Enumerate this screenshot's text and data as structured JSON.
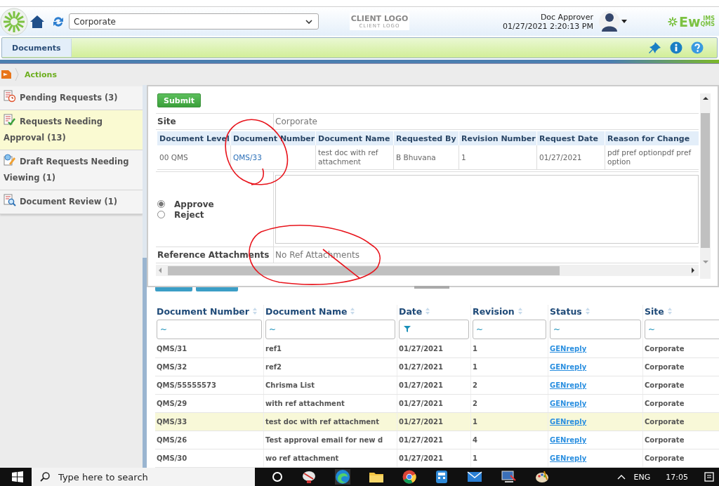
{
  "header": {
    "site_select": "Corporate",
    "client_logo": {
      "title": "CLIENT LOGO",
      "subtitle": "CLIENT LOGO"
    },
    "user": {
      "name": "Doc Approver",
      "datetime": "01/27/2021 2:20:13 PM"
    },
    "brand": {
      "name": "Ew",
      "top": "IMS",
      "bottom": "QMS"
    }
  },
  "nav": {
    "tabs": [
      {
        "label": "Documents",
        "selected": true
      }
    ]
  },
  "breadcrumb": {
    "label": "Actions"
  },
  "sidebar": {
    "items": [
      {
        "label": "Pending Requests (3)",
        "kind": "pending",
        "selected": false
      },
      {
        "label": "Requests Needing Approval (13)",
        "kind": "approval",
        "selected": true
      },
      {
        "label": "Draft Requests Needing Viewing (1)",
        "kind": "draft",
        "selected": false
      },
      {
        "label": "Document Review (1)",
        "kind": "review",
        "selected": false
      }
    ]
  },
  "request_form": {
    "submit": "Submit",
    "site": {
      "label": "Site",
      "value": "Corporate"
    },
    "details": {
      "columns": [
        {
          "label": "Document Level",
          "kind": "text"
        },
        {
          "label": "Document Number",
          "kind": "link"
        },
        {
          "label": "Document Name",
          "kind": "text"
        },
        {
          "label": "Requested By",
          "kind": "text"
        },
        {
          "label": "Revision Number",
          "kind": "text"
        },
        {
          "label": "Request Date",
          "kind": "text"
        },
        {
          "label": "Reason for Change",
          "kind": "text"
        }
      ],
      "rows": [
        {
          "cells": [
            "00 QMS",
            "QMS/33",
            "test doc with ref attachment",
            "B Bhuvana",
            "1",
            "01/27/2021",
            "pdf pref optionpdf pref option"
          ]
        }
      ]
    },
    "decision": [
      {
        "label": "Approve",
        "selected": true
      },
      {
        "label": "Reject",
        "selected": false
      }
    ],
    "attachments": {
      "label": "Reference Attachments",
      "value": "No Ref Attachments"
    }
  },
  "documents_grid": {
    "columns": [
      {
        "label": "Document Number",
        "kind": "text",
        "filter": {
          "kind": "text",
          "value": "~"
        }
      },
      {
        "label": "Document Name",
        "kind": "text",
        "filter": {
          "kind": "text",
          "value": "~"
        }
      },
      {
        "label": "Date",
        "kind": "text",
        "filter": {
          "kind": "date"
        }
      },
      {
        "label": "Revision",
        "kind": "text",
        "filter": {
          "kind": "text",
          "value": "~"
        }
      },
      {
        "label": "Status",
        "kind": "link",
        "filter": {
          "kind": "text",
          "value": "~"
        }
      },
      {
        "label": "Site",
        "kind": "text",
        "filter": {
          "kind": "text",
          "value": "~"
        }
      }
    ],
    "rows": [
      {
        "cells": [
          "QMS/31",
          "ref1",
          "01/27/2021",
          "1",
          "GENreply",
          "Corporate"
        ],
        "selected": false
      },
      {
        "cells": [
          "QMS/32",
          "ref2",
          "01/27/2021",
          "1",
          "GENreply",
          "Corporate"
        ],
        "selected": false
      },
      {
        "cells": [
          "QMS/55555573",
          "Chrisma List",
          "01/27/2021",
          "2",
          "GENreply",
          "Corporate"
        ],
        "selected": false
      },
      {
        "cells": [
          "QMS/29",
          "with ref attachment",
          "01/27/2021",
          "2",
          "GENreply",
          "Corporate"
        ],
        "selected": false
      },
      {
        "cells": [
          "QMS/33",
          "test doc with ref attachment",
          "01/27/2021",
          "1",
          "GENreply",
          "Corporate"
        ],
        "selected": true
      },
      {
        "cells": [
          "QMS/26",
          "Test approval email for new d",
          "01/27/2021",
          "4",
          "GENreply",
          "Corporate"
        ],
        "selected": false
      },
      {
        "cells": [
          "QMS/30",
          "wo ref attachment",
          "01/27/2021",
          "1",
          "GENreply",
          "Corporate"
        ],
        "selected": false
      }
    ]
  },
  "taskbar": {
    "search_placeholder": "Type here to search",
    "language": "ENG",
    "time": "17:05"
  },
  "annotations": [
    {
      "kind": "loop"
    },
    {
      "kind": "loop"
    }
  ]
}
